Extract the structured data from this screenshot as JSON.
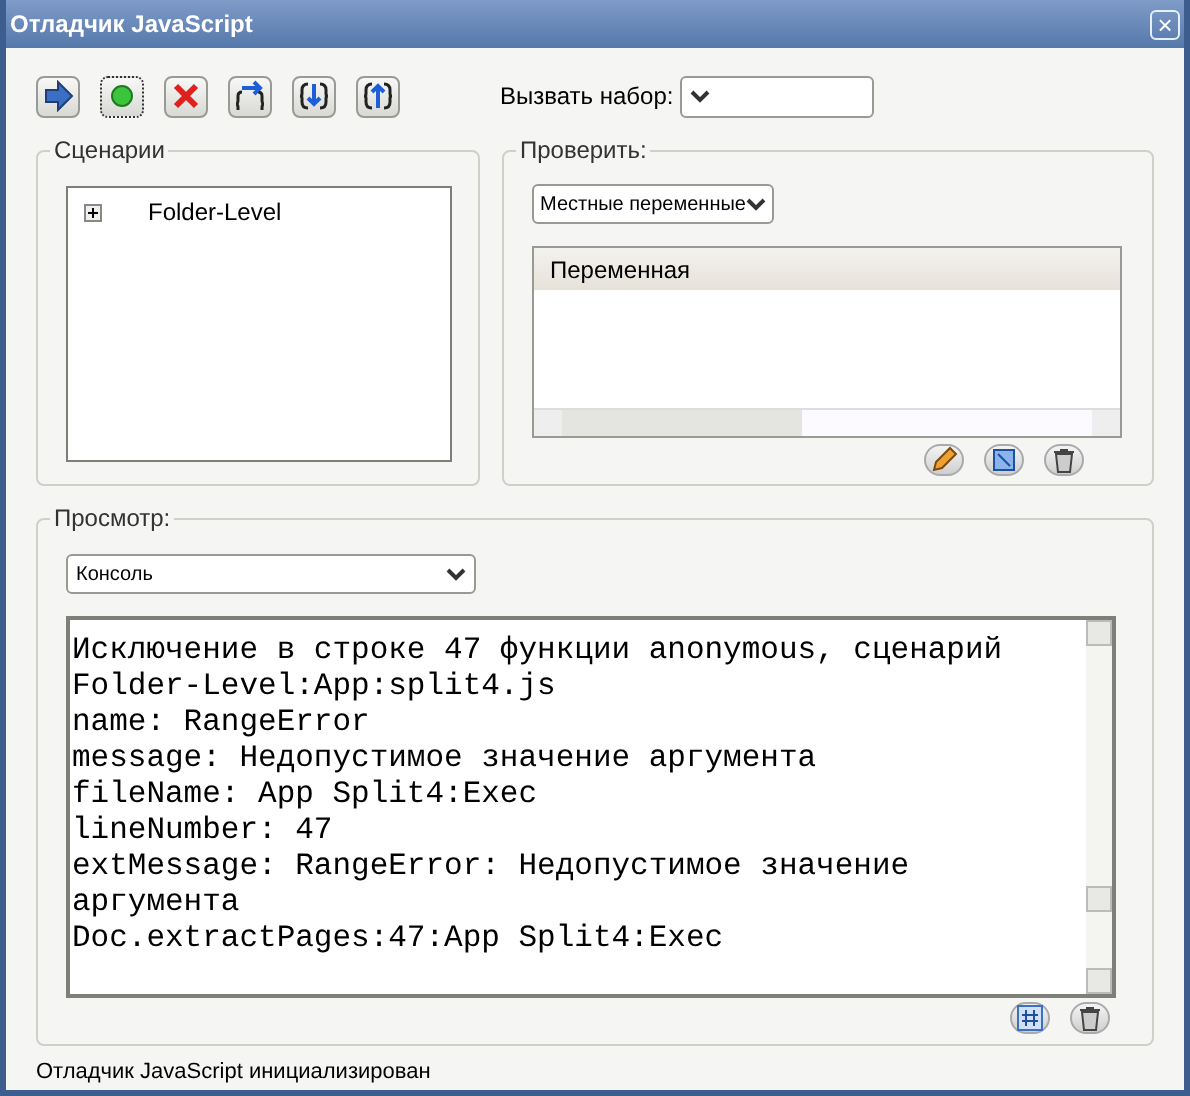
{
  "window": {
    "title": "Отладчик JavaScript",
    "close": "×"
  },
  "toolbar": [
    {
      "kind": "resume",
      "focused": false
    },
    {
      "kind": "stop",
      "focused": true
    },
    {
      "kind": "cancel",
      "focused": false
    },
    {
      "kind": "step_over",
      "focused": false
    },
    {
      "kind": "step_into",
      "focused": false
    },
    {
      "kind": "step_out",
      "focused": false
    }
  ],
  "call_stack": {
    "label": "Вызвать набор:"
  },
  "scripts": {
    "title": "Сценарии",
    "tree": [
      {
        "label": "Folder-Level",
        "expanded": false
      }
    ]
  },
  "inspect": {
    "title": "Проверить:",
    "dropdown": "Местные переменные",
    "table": {
      "columns": [
        "Переменная"
      ]
    },
    "actions": [
      {
        "kind": "edit"
      },
      {
        "kind": "watch"
      },
      {
        "kind": "delete"
      }
    ]
  },
  "view": {
    "title": "Просмотр:",
    "dropdown": "Консоль",
    "console_lines": [
      "Исключение в строке 47 функции anonymous, сценарий",
      "Folder-Level:App:split4.js",
      "name: RangeError",
      "message: Недопустимое значение аргумента",
      "fileName: App Split4:Exec",
      "lineNumber: 47",
      "extMessage: RangeError: Недопустимое значение",
      "аргумента",
      "Doc.extractPages:47:App Split4:Exec"
    ],
    "actions": [
      {
        "kind": "hash"
      },
      {
        "kind": "delete"
      }
    ]
  },
  "status_bar": "Отладчик JavaScript инициализирован"
}
